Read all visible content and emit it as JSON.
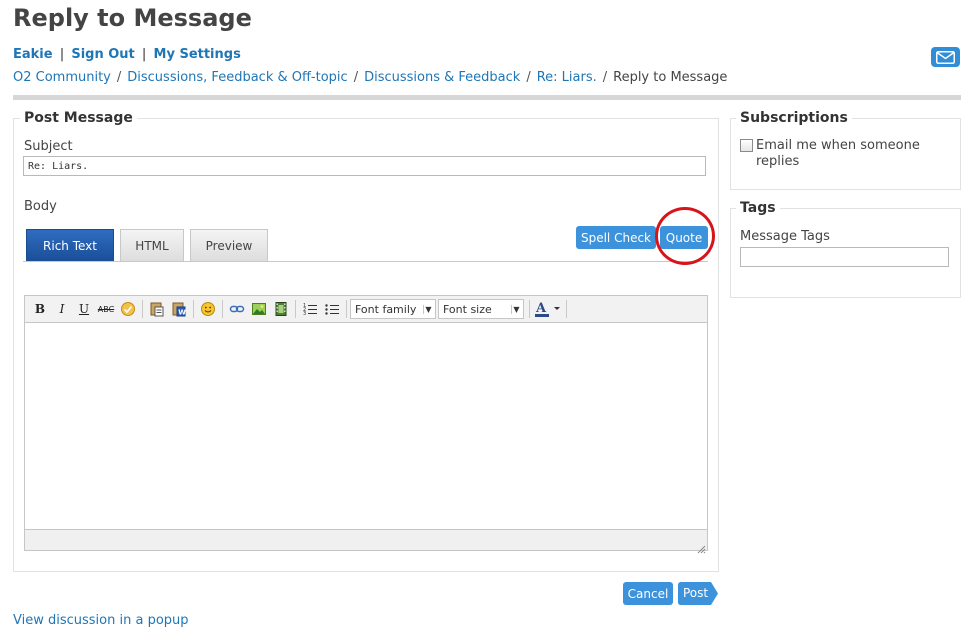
{
  "header": {
    "title": "Reply to Message",
    "user_name": "Eakie",
    "sign_out": "Sign Out",
    "my_settings": "My Settings",
    "nav_separator": "|",
    "mail_icon": "envelope-icon"
  },
  "breadcrumb": {
    "items": [
      "O2 Community",
      "Discussions, Feedback & Off-topic",
      "Discussions & Feedback",
      "Re: Liars."
    ],
    "current": "Reply to Message",
    "separator": "/"
  },
  "post": {
    "title": "Post Message",
    "subject_label": "Subject",
    "subject_value": "Re: Liars.",
    "body_label": "Body",
    "tabs": [
      "Rich Text",
      "HTML",
      "Preview"
    ],
    "active_tab": "Rich Text",
    "spell_check": "Spell Check",
    "quote": "Quote",
    "font_family": "Font family",
    "font_size": "Font size",
    "cancel": "Cancel",
    "post": "Post"
  },
  "subscriptions": {
    "title": "Subscriptions",
    "email_label_line1": "Email me when someone",
    "email_label_line2": "replies",
    "checked": false
  },
  "tags": {
    "title": "Tags",
    "message_tags_label": "Message Tags",
    "value": ""
  },
  "footer": {
    "partial_link": "View discussion in a popup"
  },
  "colors": {
    "link": "#1f76b6",
    "button": "#3c93db",
    "active_tab": "#1b4f98",
    "highlight": "#d8141b"
  }
}
